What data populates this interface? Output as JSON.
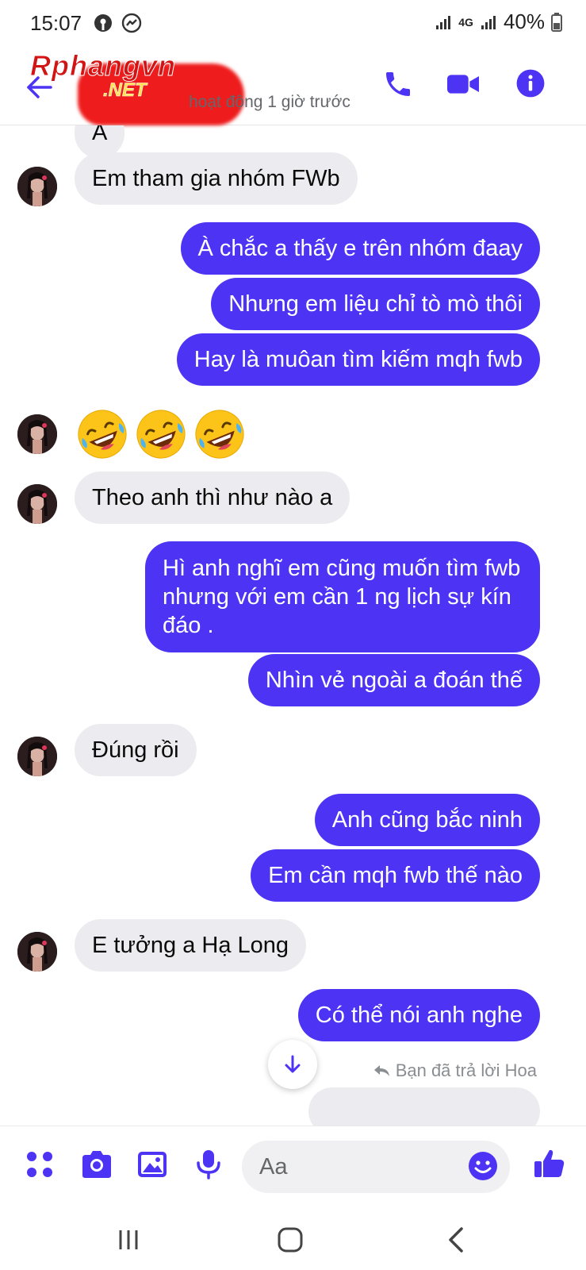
{
  "status_bar": {
    "time": "15:07",
    "network": "4G",
    "battery": "40%"
  },
  "header": {
    "watermark_brand": "Rphangvn",
    "watermark_domain": ".NET",
    "active_status": "hoạt động 1 giờ trước"
  },
  "messages": [
    {
      "id": "m0",
      "side": "in",
      "text": "A"
    },
    {
      "id": "m1",
      "side": "in",
      "text": "Em tham gia nhóm FWb"
    },
    {
      "id": "m2",
      "side": "out",
      "text": "À chắc a thấy e trên nhóm đaay"
    },
    {
      "id": "m3",
      "side": "out",
      "text": "Nhưng em liệu chỉ tò mò thôi"
    },
    {
      "id": "m4",
      "side": "out",
      "text": "Hay là muôan tìm kiếm mqh fwb"
    },
    {
      "id": "m5",
      "side": "in",
      "text": "🤣🤣🤣"
    },
    {
      "id": "m6",
      "side": "in",
      "text": "Theo anh thì như nào a"
    },
    {
      "id": "m7",
      "side": "out",
      "text": "Hì anh nghĩ em cũng muốn tìm fwb nhưng với em cần 1 ng lịch sự kín đáo ."
    },
    {
      "id": "m8",
      "side": "out",
      "text": "Nhìn vẻ ngoài a đoán thế"
    },
    {
      "id": "m9",
      "side": "in",
      "text": "Đúng rồi"
    },
    {
      "id": "m10",
      "side": "out",
      "text": "Anh cũng bắc ninh"
    },
    {
      "id": "m11",
      "side": "out",
      "text": "Em cần mqh fwb thế nào"
    },
    {
      "id": "m12",
      "side": "in",
      "text": "E tưởng a Hạ Long"
    },
    {
      "id": "m13",
      "side": "out",
      "text": "Có thể nói anh nghe"
    }
  ],
  "reply_note": "Bạn đã trả lời Hoa",
  "composer": {
    "placeholder": "Aa"
  },
  "colors": {
    "accent": "#4d34f5",
    "incoming_bubble": "#ececf0",
    "outgoing_bubble": "#4d34f5"
  },
  "icons": {
    "back": "arrow-left-icon",
    "call": "phone-icon",
    "video": "video-camera-icon",
    "info": "info-icon",
    "scroll": "arrow-down-icon",
    "menu": "four-dots-icon",
    "camera": "camera-icon",
    "gallery": "image-icon",
    "voice": "microphone-icon",
    "emoji": "smiley-icon",
    "like": "thumbs-up-icon"
  }
}
